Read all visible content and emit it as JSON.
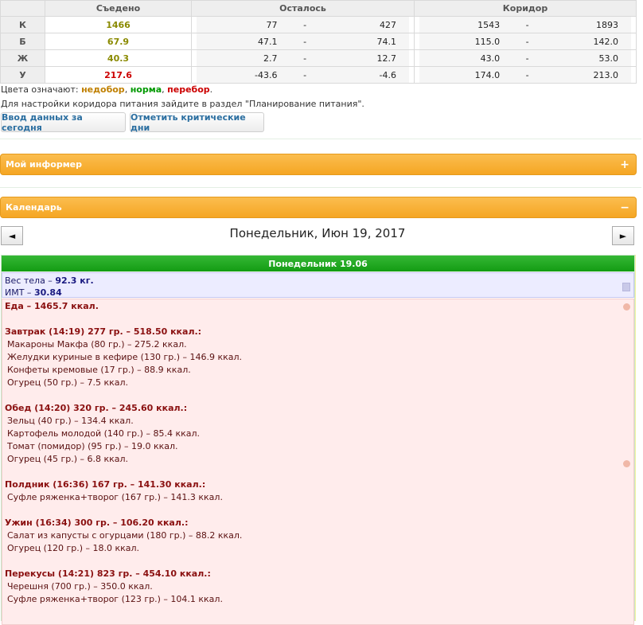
{
  "table": {
    "headers": {
      "eaten": "Съедено",
      "left": "Осталось",
      "corridor": "Коридор"
    },
    "rows": [
      {
        "label": "К",
        "eaten": "1466",
        "eaten_color": "#8a8a00",
        "left_lo": "77",
        "left_hi": "427",
        "corr_lo": "1543",
        "corr_hi": "1893"
      },
      {
        "label": "Б",
        "eaten": "67.9",
        "eaten_color": "#8a8a00",
        "left_lo": "47.1",
        "left_hi": "74.1",
        "corr_lo": "115.0",
        "corr_hi": "142.0"
      },
      {
        "label": "Ж",
        "eaten": "40.3",
        "eaten_color": "#8a8a00",
        "left_lo": "2.7",
        "left_hi": "12.7",
        "corr_lo": "43.0",
        "corr_hi": "53.0"
      },
      {
        "label": "У",
        "eaten": "217.6",
        "eaten_color": "#cc0000",
        "left_lo": "-43.6",
        "left_hi": "-4.6",
        "corr_lo": "174.0",
        "corr_hi": "213.0"
      }
    ],
    "dash": "-"
  },
  "legend": {
    "prefix": "Цвета означают:",
    "under": "недобор",
    "norm": "норма",
    "over": "перебор",
    "sep": ",",
    "end": "."
  },
  "hint": "Для настройки коридора питания зайдите в раздел \"Планирование питания\".",
  "buttons": {
    "enter_today": "Ввод данных за сегодня",
    "critical_days": "Отметить критические дни"
  },
  "panels": {
    "informer": {
      "label": "Мой информер",
      "sym": "+"
    },
    "calendar": {
      "label": "Календарь",
      "sym": "−"
    }
  },
  "calendar": {
    "prev": "◄",
    "next": "►",
    "title": "Понедельник, Июн 19, 2017",
    "day_header": "Понедельник 19.06",
    "weight_label": "Вес тела –",
    "weight_value": "92.3 кг.",
    "bmi_label": "ИМТ –",
    "bmi_value": "30.84",
    "food_label": "Еда –",
    "food_value": "1465.7 ккал."
  },
  "meals": [
    {
      "title": "Завтрак (14:19) 277 гр. – 518.50 ккал.:",
      "items": [
        "Макароны Макфа (80 гр.) – 275.2 ккал.",
        "Желудки куриные в кефире (130 гр.) – 146.9 ккал.",
        "Конфеты кремовые (17 гр.) – 88.9 ккал.",
        "Огурец (50 гр.) – 7.5 ккал."
      ]
    },
    {
      "title": "Обед (14:20) 320 гр. – 245.60 ккал.:",
      "items": [
        "Зельц (40 гр.) – 134.4 ккал.",
        "Картофель молодой (140 гр.) – 85.4 ккал.",
        "Томат (помидор) (95 гр.) – 19.0 ккал.",
        "Огурец (45 гр.) – 6.8 ккал."
      ]
    },
    {
      "title": "Полдник (16:36) 167 гр. – 141.30 ккал.:",
      "items": [
        "Суфле ряженка+творог (167 гр.) – 141.3 ккал."
      ]
    },
    {
      "title": "Ужин (16:34) 300 гр. – 106.20 ккал.:",
      "items": [
        "Салат из капусты с огурцами (180 гр.) – 88.2 ккал.",
        "Огурец (120 гр.) – 18.0 ккал."
      ]
    },
    {
      "title": "Перекусы (14:21) 823 гр. – 454.10 ккал.:",
      "items": [
        "Черешня (700 гр.) – 350.0 ккал.",
        "Суфле ряженка+творог (123 гр.) – 104.1 ккал."
      ]
    }
  ]
}
